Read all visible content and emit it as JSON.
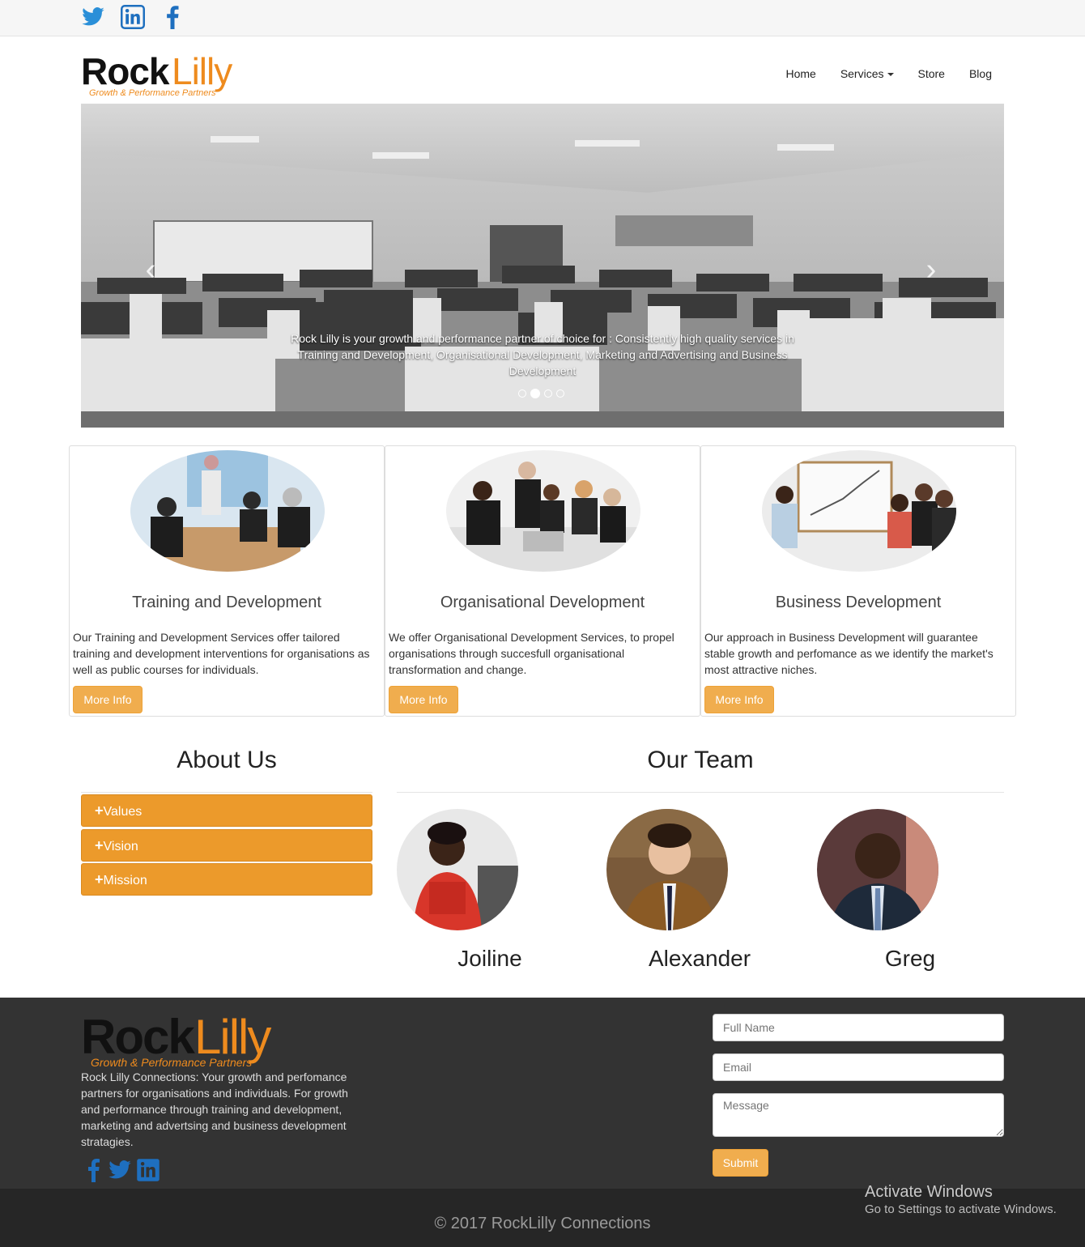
{
  "social_top": [
    "twitter-icon",
    "linkedin-icon",
    "facebook-icon"
  ],
  "brand": {
    "name_a": "Rock",
    "name_b": "Lilly",
    "tagline": "Growth & Performance Partners"
  },
  "nav": {
    "home": "Home",
    "services": "Services",
    "store": "Store",
    "blog": "Blog"
  },
  "carousel": {
    "caption": "Rock Lilly is your growth and performance partner of choice for : Consistently high quality services in Training and Development, Organisational Development, Marketing and Advertising and Business Development",
    "prev_icon": "chevron-left-icon",
    "next_icon": "chevron-right-icon",
    "slide_count": 4,
    "active_slide": 2
  },
  "cards": [
    {
      "title": "Training and Development",
      "text": "Our Training and Development Services offer tailored training and development interventions for organisations as well as public courses for individuals.",
      "button": "More Info"
    },
    {
      "title": "Organisational Development",
      "text": "We offer Organisational Development Services, to propel organisations through succesfull organisational transformation and change.",
      "button": "More Info"
    },
    {
      "title": "Business Development",
      "text": "Our approach in Business Development will guarantee stable growth and perfomance as we identify the market's most attractive niches.",
      "button": "More Info"
    }
  ],
  "about": {
    "title": "About Us",
    "items": [
      "Values",
      "Vision",
      "Mission"
    ]
  },
  "team": {
    "title": "Our Team",
    "members": [
      "Joiline",
      "Alexander",
      "Greg"
    ]
  },
  "footer": {
    "text": "Rock Lilly Connections: Your growth and perfomance partners for organisations and individuals. For growth and performance through training and development, marketing and advertsing and business development stratagies.",
    "form": {
      "name_placeholder": "Full Name",
      "email_placeholder": "Email",
      "message_placeholder": "Message",
      "submit": "Submit"
    },
    "social": [
      "facebook-icon",
      "twitter-icon",
      "linkedin-icon"
    ],
    "copyright": "© 2017 RockLilly Connections"
  },
  "watermark": {
    "line1": "Activate Windows",
    "line2": "Go to Settings to activate Windows."
  },
  "colors": {
    "accent": "#f0ad4e",
    "accordion": "#ec9a2b",
    "brand_orange": "#ee8b1e",
    "footer_bg": "#333333",
    "social_blue": "#1e6fbf"
  }
}
